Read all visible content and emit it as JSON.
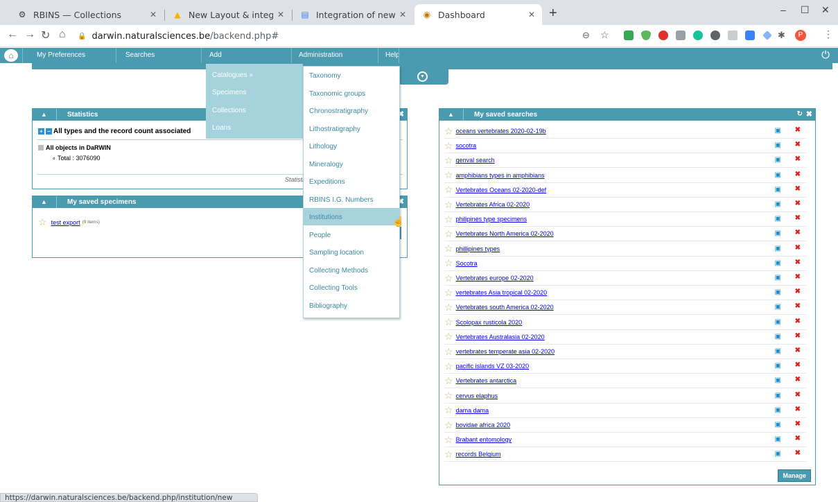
{
  "browser": {
    "tabs": [
      {
        "title": "RBINS — Collections",
        "icon": "gear-icon"
      },
      {
        "title": "New Layout & integration",
        "icon": "google-drive-icon"
      },
      {
        "title": "Integration of new DaRW",
        "icon": "google-docs-icon"
      },
      {
        "title": "Dashboard",
        "icon": "darwin-icon"
      }
    ],
    "url_host": "darwin.naturalsciences.be",
    "url_path": "/backend.php#",
    "profile_initial": "P",
    "status_url": "https://darwin.naturalsciences.be/backend.php/institution/new"
  },
  "menu": {
    "items": [
      "My Preferences",
      "Searches",
      "Add",
      "Administration",
      "Help"
    ]
  },
  "add_menu": {
    "items": [
      "Catalogues »",
      "Specimens",
      "Collections",
      "Loans"
    ]
  },
  "admin_menu": {
    "items": [
      "Taxonomy",
      "Taxonomic groups",
      "Chronostratigraphy",
      "Lithostratigraphy",
      "Lithology",
      "Mineralogy",
      "Expeditions",
      "RBINS I.G. Numbers",
      "Institutions",
      "People",
      "Sampling location",
      "Collecting Methods",
      "Collecting Tools",
      "Bibliography"
    ],
    "hover_index": 8
  },
  "statistics": {
    "title": "Statistics",
    "heading": "All types and the record count associated",
    "objects_label": "All objects in DaRWIN",
    "total": "Total : 3076090",
    "footer": "Statistics"
  },
  "saved_specimens": {
    "title": "My saved specimens",
    "items": [
      {
        "name": "test export",
        "count": "(9 items)"
      }
    ]
  },
  "saved_searches": {
    "title": "My saved searches",
    "items": [
      "oceans vertebrates 2020-02-19b",
      "socotra",
      "genval search",
      "amphibians types in amphibians",
      "Vertebrates Oceans 02-2020-def",
      "Vertebrates Africa 02-2020",
      "philipines type specimens",
      "Vertebrates North America 02-2020",
      "phillipines types",
      "Socotra",
      "Vertebrates europe 02-2020",
      "vertebrates Asia tropical 02-2020",
      "Vertebrates south America 02-2020",
      "Scolopax rusticola 2020",
      "Vertebrates Australasia 02-2020",
      "vertebrates temperate asia 02-2020",
      "pacific islands VZ 03-2020",
      "Vertebrates antarctica",
      "cervus elaphus",
      "dama dama",
      "bovidae africa 2020",
      "Brabant entomology",
      "records Belgium"
    ],
    "manage_label": "Manage"
  },
  "colors": {
    "accent": "#4a9ab0",
    "menu_light": "#a5d2dc"
  }
}
